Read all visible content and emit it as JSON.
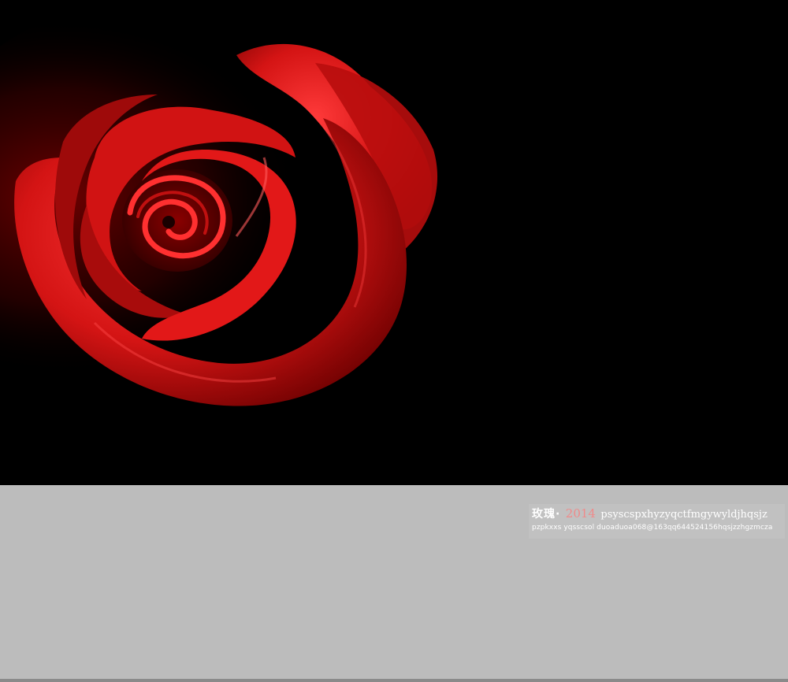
{
  "image": {
    "subject": "red-rose-icon",
    "colors": {
      "background": "#000000",
      "petal_dark": "#5a0000",
      "petal_mid": "#c81010",
      "petal_bright": "#ff2a2a",
      "lower_panel": "#bcbcbc"
    }
  },
  "signature": {
    "title": "玫瑰·",
    "year": "2014",
    "tail": "psyscspxhyzyqctfmgywyldjhqsjz",
    "line2": "pzpkxxs yqsscsol duoaduoa068@163qq644524156hqsjzzhgzmcza"
  }
}
